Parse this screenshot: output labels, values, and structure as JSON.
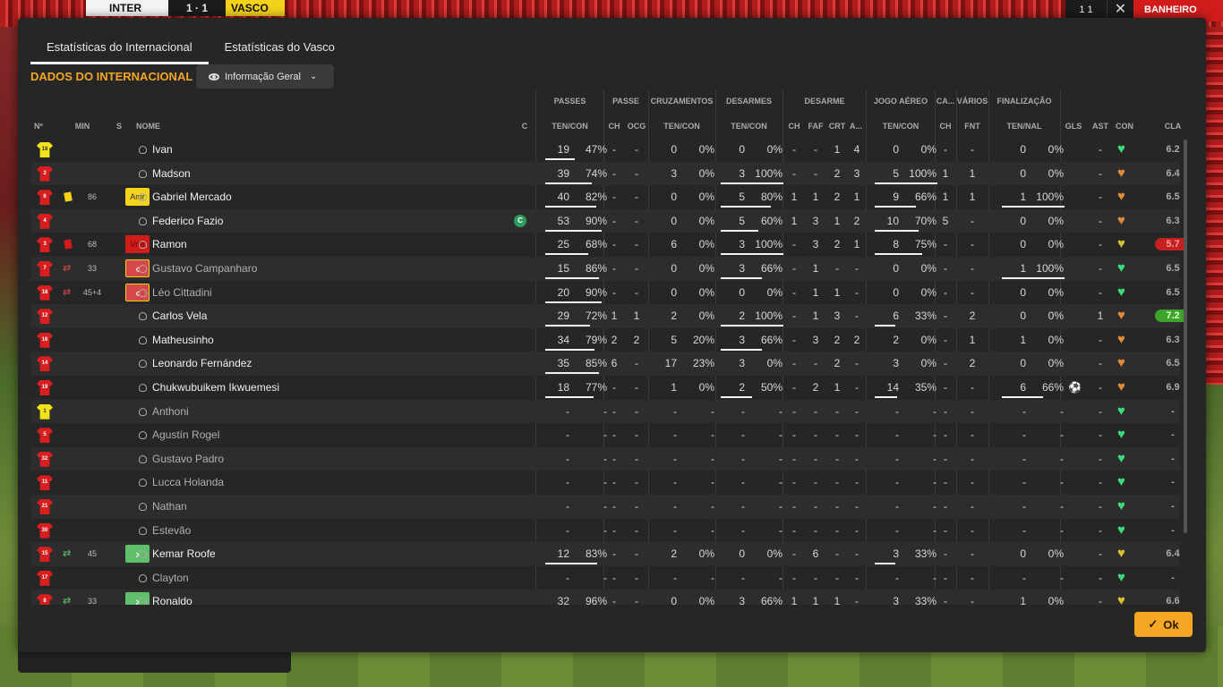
{
  "scoreboard": {
    "home": "INTER",
    "score": "1 · 1",
    "away": "VASCO",
    "right_score": "1 1",
    "right_label": "BANHEIRO"
  },
  "tabs": [
    "Estatísticas do Internacional",
    "Estatísticas do Vasco"
  ],
  "section_title": "DADOS DO INTERNACIONAL",
  "dropdown_label": "Informação Geral",
  "ok_label": "Ok",
  "groups": [
    "PASSES",
    "PASSE",
    "CRUZAMENTOS",
    "DESARMES",
    "DESARME",
    "JOGO AÉREO",
    "CA...",
    "VÁRIOS",
    "FINALIZAÇÃO"
  ],
  "subheaders": {
    "no": "Nº",
    "min": "MIN",
    "s": "S",
    "nome": "NOME",
    "c": "C",
    "passes": "TEN/CON",
    "passe_ch": "CH",
    "passe_ocg": "OCG",
    "cruz": "TEN/CON",
    "desarmes": "TEN/CON",
    "des_ch": "CH",
    "des_faf": "FAF",
    "des_crt": "CRT",
    "des_a": "A...",
    "aereo": "TEN/CON",
    "ca_ch": "CH",
    "fnt": "FNT",
    "final": "TEN/NAL",
    "gls": "GLS",
    "ast": "AST",
    "con": "CON",
    "cla": "CLA"
  },
  "colors": {
    "accent": "#f5a623",
    "heart_green": "#3ddc7a",
    "heart_orange": "#e08a3a",
    "heart_yellow": "#d8c030"
  },
  "players": [
    {
      "no": "18",
      "shirt": "yellow",
      "min": "",
      "card": "",
      "badge": "",
      "name": "Ivan",
      "sub": false,
      "cap": false,
      "pas": [
        "19",
        "47%"
      ],
      "pbar": 0.47,
      "pch": "-",
      "pocg": "-",
      "cru": [
        "0",
        "0%"
      ],
      "des": [
        "0",
        "0%"
      ],
      "dbar": 0,
      "dch": "-",
      "dfaf": "-",
      "dcrt": "1",
      "da": "4",
      "aer": [
        "0",
        "0%"
      ],
      "abar": 0,
      "cach": "-",
      "fnt": "-",
      "fin": [
        "0",
        "0%"
      ],
      "fbar": 0,
      "ball": false,
      "gls": "",
      "ast": "-",
      "heart": "green",
      "cla": "6.2",
      "cla_style": "plain"
    },
    {
      "no": "2",
      "shirt": "red",
      "min": "",
      "card": "",
      "badge": "",
      "name": "Madson",
      "sub": false,
      "cap": false,
      "pas": [
        "39",
        "74%"
      ],
      "pbar": 0.74,
      "pch": "-",
      "pocg": "-",
      "cru": [
        "3",
        "0%"
      ],
      "des": [
        "3",
        "100%"
      ],
      "dbar": 1,
      "dch": "-",
      "dfaf": "-",
      "dcrt": "2",
      "da": "3",
      "aer": [
        "5",
        "100%"
      ],
      "abar": 1,
      "cach": "1",
      "fnt": "1",
      "fin": [
        "0",
        "0%"
      ],
      "fbar": 0,
      "ball": false,
      "gls": "",
      "ast": "-",
      "heart": "orange",
      "cla": "6.4",
      "cla_style": "plain"
    },
    {
      "no": "6",
      "shirt": "red",
      "min": "86",
      "card": "yellow",
      "badge": "Amr",
      "name": "Gabriel Mercado",
      "sub": false,
      "cap": false,
      "pas": [
        "40",
        "82%"
      ],
      "pbar": 0.82,
      "pch": "-",
      "pocg": "-",
      "cru": [
        "0",
        "0%"
      ],
      "des": [
        "5",
        "80%"
      ],
      "dbar": 0.8,
      "dch": "1",
      "dfaf": "1",
      "dcrt": "2",
      "da": "1",
      "aer": [
        "9",
        "66%"
      ],
      "abar": 0.66,
      "cach": "1",
      "fnt": "1",
      "fin": [
        "1",
        "100%"
      ],
      "fbar": 1,
      "ball": false,
      "gls": "",
      "ast": "-",
      "heart": "orange",
      "cla": "6.5",
      "cla_style": "plain"
    },
    {
      "no": "4",
      "shirt": "red",
      "min": "",
      "card": "",
      "badge": "",
      "name": "Federico Fazio",
      "sub": false,
      "cap": true,
      "pas": [
        "53",
        "90%"
      ],
      "pbar": 0.9,
      "pch": "-",
      "pocg": "-",
      "cru": [
        "0",
        "0%"
      ],
      "des": [
        "5",
        "60%"
      ],
      "dbar": 0.6,
      "dch": "1",
      "dfaf": "3",
      "dcrt": "1",
      "da": "2",
      "aer": [
        "10",
        "70%"
      ],
      "abar": 0.7,
      "cach": "5",
      "fnt": "-",
      "fin": [
        "0",
        "0%"
      ],
      "fbar": 0,
      "ball": false,
      "gls": "",
      "ast": "-",
      "heart": "orange",
      "cla": "6.3",
      "cla_style": "plain"
    },
    {
      "no": "3",
      "shirt": "red",
      "min": "68",
      "card": "red",
      "badge": "Vrm",
      "name": "Ramon",
      "sub": false,
      "cap": false,
      "pas": [
        "25",
        "68%"
      ],
      "pbar": 0.68,
      "pch": "-",
      "pocg": "-",
      "cru": [
        "6",
        "0%"
      ],
      "des": [
        "3",
        "100%"
      ],
      "dbar": 1,
      "dch": "-",
      "dfaf": "3",
      "dcrt": "2",
      "da": "1",
      "aer": [
        "8",
        "75%"
      ],
      "abar": 0.75,
      "cach": "-",
      "fnt": "-",
      "fin": [
        "0",
        "0%"
      ],
      "fbar": 0,
      "ball": false,
      "gls": "",
      "ast": "-",
      "heart": "yellow",
      "cla": "5.7",
      "cla_style": "red"
    },
    {
      "no": "7",
      "shirt": "red",
      "min": "33",
      "card": "subout",
      "badge": "out",
      "name": "Gustavo Campanharo",
      "sub": true,
      "cap": false,
      "pas": [
        "15",
        "86%"
      ],
      "pbar": 0.86,
      "pch": "-",
      "pocg": "-",
      "cru": [
        "0",
        "0%"
      ],
      "des": [
        "3",
        "66%"
      ],
      "dbar": 0.66,
      "dch": "-",
      "dfaf": "1",
      "dcrt": "-",
      "da": "-",
      "aer": [
        "0",
        "0%"
      ],
      "abar": 0,
      "cach": "-",
      "fnt": "-",
      "fin": [
        "1",
        "100%"
      ],
      "fbar": 1,
      "ball": false,
      "gls": "",
      "ast": "-",
      "heart": "green",
      "cla": "6.5",
      "cla_style": "plain"
    },
    {
      "no": "18",
      "shirt": "red",
      "min": "45+4",
      "card": "subout",
      "badge": "out",
      "name": "Léo Cittadini",
      "sub": true,
      "cap": false,
      "pas": [
        "20",
        "90%"
      ],
      "pbar": 0.9,
      "pch": "-",
      "pocg": "-",
      "cru": [
        "0",
        "0%"
      ],
      "des": [
        "0",
        "0%"
      ],
      "dbar": 0,
      "dch": "-",
      "dfaf": "1",
      "dcrt": "1",
      "da": "-",
      "aer": [
        "0",
        "0%"
      ],
      "abar": 0,
      "cach": "-",
      "fnt": "-",
      "fin": [
        "0",
        "0%"
      ],
      "fbar": 0,
      "ball": false,
      "gls": "",
      "ast": "-",
      "heart": "green",
      "cla": "6.5",
      "cla_style": "plain"
    },
    {
      "no": "12",
      "shirt": "red",
      "min": "",
      "card": "",
      "badge": "",
      "name": "Carlos Vela",
      "sub": false,
      "cap": false,
      "pas": [
        "29",
        "72%"
      ],
      "pbar": 0.72,
      "pch": "1",
      "pocg": "1",
      "cru": [
        "2",
        "0%"
      ],
      "des": [
        "2",
        "100%"
      ],
      "dbar": 1,
      "dch": "-",
      "dfaf": "1",
      "dcrt": "3",
      "da": "-",
      "aer": [
        "6",
        "33%"
      ],
      "abar": 0.33,
      "cach": "-",
      "fnt": "2",
      "fin": [
        "0",
        "0%"
      ],
      "fbar": 0,
      "ball": false,
      "gls": "",
      "ast": "1",
      "heart": "orange",
      "cla": "7.2",
      "cla_style": "green"
    },
    {
      "no": "16",
      "shirt": "red",
      "min": "",
      "card": "",
      "badge": "",
      "name": "Matheusinho",
      "sub": false,
      "cap": false,
      "pas": [
        "34",
        "79%"
      ],
      "pbar": 0.79,
      "pch": "2",
      "pocg": "2",
      "cru": [
        "5",
        "20%"
      ],
      "des": [
        "3",
        "66%"
      ],
      "dbar": 0.66,
      "dch": "-",
      "dfaf": "3",
      "dcrt": "2",
      "da": "2",
      "aer": [
        "2",
        "0%"
      ],
      "abar": 0,
      "cach": "-",
      "fnt": "1",
      "fin": [
        "1",
        "0%"
      ],
      "fbar": 0,
      "ball": false,
      "gls": "",
      "ast": "-",
      "heart": "orange",
      "cla": "6.3",
      "cla_style": "plain"
    },
    {
      "no": "14",
      "shirt": "red",
      "min": "",
      "card": "",
      "badge": "",
      "name": "Leonardo Fernández",
      "sub": false,
      "cap": false,
      "pas": [
        "35",
        "85%"
      ],
      "pbar": 0.85,
      "pch": "6",
      "pocg": "-",
      "cru": [
        "17",
        "23%"
      ],
      "des": [
        "3",
        "0%"
      ],
      "dbar": 0,
      "dch": "-",
      "dfaf": "-",
      "dcrt": "2",
      "da": "-",
      "aer": [
        "3",
        "0%"
      ],
      "abar": 0,
      "cach": "-",
      "fnt": "2",
      "fin": [
        "0",
        "0%"
      ],
      "fbar": 0,
      "ball": false,
      "gls": "",
      "ast": "-",
      "heart": "orange",
      "cla": "6.5",
      "cla_style": "plain"
    },
    {
      "no": "19",
      "shirt": "red",
      "min": "",
      "card": "",
      "badge": "",
      "name": "Chukwubuikem Ikwuemesi",
      "sub": false,
      "cap": false,
      "pas": [
        "18",
        "77%"
      ],
      "pbar": 0.77,
      "pch": "-",
      "pocg": "-",
      "cru": [
        "1",
        "0%"
      ],
      "des": [
        "2",
        "50%"
      ],
      "dbar": 0.5,
      "dch": "-",
      "dfaf": "2",
      "dcrt": "1",
      "da": "-",
      "aer": [
        "14",
        "35%"
      ],
      "abar": 0.35,
      "cach": "-",
      "fnt": "-",
      "fin": [
        "6",
        "66%"
      ],
      "fbar": 0.66,
      "ball": true,
      "gls": "",
      "ast": "-",
      "heart": "orange",
      "cla": "6.9",
      "cla_style": "plain"
    },
    {
      "no": "1",
      "shirt": "yellow",
      "min": "",
      "card": "",
      "badge": "",
      "name": "Anthoni",
      "sub": true,
      "cap": false,
      "pas": [
        "-",
        "-"
      ],
      "pbar": 0,
      "pch": "-",
      "pocg": "-",
      "cru": [
        "-",
        "-"
      ],
      "des": [
        "-",
        "-"
      ],
      "dbar": 0,
      "dch": "-",
      "dfaf": "-",
      "dcrt": "-",
      "da": "-",
      "aer": [
        "-",
        "-"
      ],
      "abar": 0,
      "cach": "-",
      "fnt": "-",
      "fin": [
        "-",
        "-"
      ],
      "fbar": 0,
      "ball": false,
      "gls": "",
      "ast": "-",
      "heart": "green",
      "cla": "-",
      "cla_style": "plain"
    },
    {
      "no": "5",
      "shirt": "red",
      "min": "",
      "card": "",
      "badge": "",
      "name": "Agustín Rogel",
      "sub": true,
      "cap": false,
      "pas": [
        "-",
        "-"
      ],
      "pbar": 0,
      "pch": "-",
      "pocg": "-",
      "cru": [
        "-",
        "-"
      ],
      "des": [
        "-",
        "-"
      ],
      "dbar": 0,
      "dch": "-",
      "dfaf": "-",
      "dcrt": "-",
      "da": "-",
      "aer": [
        "-",
        "-"
      ],
      "abar": 0,
      "cach": "-",
      "fnt": "-",
      "fin": [
        "-",
        "-"
      ],
      "fbar": 0,
      "ball": false,
      "gls": "",
      "ast": "-",
      "heart": "green",
      "cla": "-",
      "cla_style": "plain"
    },
    {
      "no": "32",
      "shirt": "red",
      "min": "",
      "card": "",
      "badge": "",
      "name": "Gustavo Padro",
      "sub": true,
      "cap": false,
      "pas": [
        "-",
        "-"
      ],
      "pbar": 0,
      "pch": "-",
      "pocg": "-",
      "cru": [
        "-",
        "-"
      ],
      "des": [
        "-",
        "-"
      ],
      "dbar": 0,
      "dch": "-",
      "dfaf": "-",
      "dcrt": "-",
      "da": "-",
      "aer": [
        "-",
        "-"
      ],
      "abar": 0,
      "cach": "-",
      "fnt": "-",
      "fin": [
        "-",
        "-"
      ],
      "fbar": 0,
      "ball": false,
      "gls": "",
      "ast": "-",
      "heart": "green",
      "cla": "-",
      "cla_style": "plain"
    },
    {
      "no": "11",
      "shirt": "red",
      "min": "",
      "card": "",
      "badge": "",
      "name": "Lucca Holanda",
      "sub": true,
      "cap": false,
      "pas": [
        "-",
        "-"
      ],
      "pbar": 0,
      "pch": "-",
      "pocg": "-",
      "cru": [
        "-",
        "-"
      ],
      "des": [
        "-",
        "-"
      ],
      "dbar": 0,
      "dch": "-",
      "dfaf": "-",
      "dcrt": "-",
      "da": "-",
      "aer": [
        "-",
        "-"
      ],
      "abar": 0,
      "cach": "-",
      "fnt": "-",
      "fin": [
        "-",
        "-"
      ],
      "fbar": 0,
      "ball": false,
      "gls": "",
      "ast": "-",
      "heart": "green",
      "cla": "-",
      "cla_style": "plain"
    },
    {
      "no": "21",
      "shirt": "red",
      "min": "",
      "card": "",
      "badge": "",
      "name": "Nathan",
      "sub": true,
      "cap": false,
      "pas": [
        "-",
        "-"
      ],
      "pbar": 0,
      "pch": "-",
      "pocg": "-",
      "cru": [
        "-",
        "-"
      ],
      "des": [
        "-",
        "-"
      ],
      "dbar": 0,
      "dch": "-",
      "dfaf": "-",
      "dcrt": "-",
      "da": "-",
      "aer": [
        "-",
        "-"
      ],
      "abar": 0,
      "cach": "-",
      "fnt": "-",
      "fin": [
        "-",
        "-"
      ],
      "fbar": 0,
      "ball": false,
      "gls": "",
      "ast": "-",
      "heart": "green",
      "cla": "-",
      "cla_style": "plain"
    },
    {
      "no": "30",
      "shirt": "red",
      "min": "",
      "card": "",
      "badge": "",
      "name": "Estevão",
      "sub": true,
      "cap": false,
      "pas": [
        "-",
        "-"
      ],
      "pbar": 0,
      "pch": "-",
      "pocg": "-",
      "cru": [
        "-",
        "-"
      ],
      "des": [
        "-",
        "-"
      ],
      "dbar": 0,
      "dch": "-",
      "dfaf": "-",
      "dcrt": "-",
      "da": "-",
      "aer": [
        "-",
        "-"
      ],
      "abar": 0,
      "cach": "-",
      "fnt": "-",
      "fin": [
        "-",
        "-"
      ],
      "fbar": 0,
      "ball": false,
      "gls": "",
      "ast": "-",
      "heart": "green",
      "cla": "-",
      "cla_style": "plain"
    },
    {
      "no": "15",
      "shirt": "red",
      "min": "45",
      "card": "subin",
      "badge": "in",
      "name": "Kemar Roofe",
      "sub": false,
      "cap": false,
      "pas": [
        "12",
        "83%"
      ],
      "pbar": 0.83,
      "pch": "-",
      "pocg": "-",
      "cru": [
        "2",
        "0%"
      ],
      "des": [
        "0",
        "0%"
      ],
      "dbar": 0,
      "dch": "-",
      "dfaf": "6",
      "dcrt": "-",
      "da": "-",
      "aer": [
        "3",
        "33%"
      ],
      "abar": 0.33,
      "cach": "-",
      "fnt": "-",
      "fin": [
        "0",
        "0%"
      ],
      "fbar": 0,
      "ball": false,
      "gls": "",
      "ast": "-",
      "heart": "yellow",
      "cla": "6.4",
      "cla_style": "plain"
    },
    {
      "no": "17",
      "shirt": "red",
      "min": "",
      "card": "",
      "badge": "",
      "name": "Clayton",
      "sub": true,
      "cap": false,
      "pas": [
        "-",
        "-"
      ],
      "pbar": 0,
      "pch": "-",
      "pocg": "-",
      "cru": [
        "-",
        "-"
      ],
      "des": [
        "-",
        "-"
      ],
      "dbar": 0,
      "dch": "-",
      "dfaf": "-",
      "dcrt": "-",
      "da": "-",
      "aer": [
        "-",
        "-"
      ],
      "abar": 0,
      "cach": "-",
      "fnt": "-",
      "fin": [
        "-",
        "-"
      ],
      "fbar": 0,
      "ball": false,
      "gls": "",
      "ast": "-",
      "heart": "green",
      "cla": "-",
      "cla_style": "plain"
    },
    {
      "no": "8",
      "shirt": "red",
      "min": "33",
      "card": "subin",
      "badge": "in",
      "name": "Ronaldo",
      "sub": false,
      "cap": false,
      "pas": [
        "32",
        "96%"
      ],
      "pbar": 0.96,
      "pch": "-",
      "pocg": "-",
      "cru": [
        "0",
        "0%"
      ],
      "des": [
        "3",
        "66%"
      ],
      "dbar": 0.66,
      "dch": "1",
      "dfaf": "1",
      "dcrt": "1",
      "da": "-",
      "aer": [
        "3",
        "33%"
      ],
      "abar": 0.33,
      "cach": "-",
      "fnt": "-",
      "fin": [
        "1",
        "0%"
      ],
      "fbar": 0,
      "ball": false,
      "gls": "",
      "ast": "-",
      "heart": "yellow",
      "cla": "6.6",
      "cla_style": "plain"
    }
  ]
}
